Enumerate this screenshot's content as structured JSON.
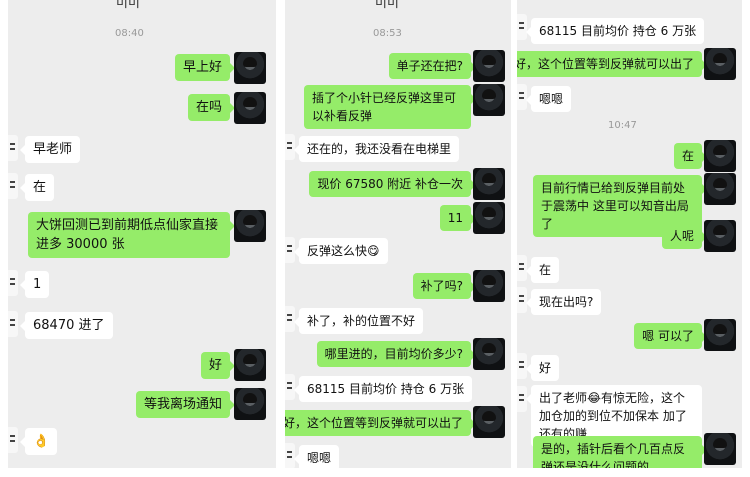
{
  "panel1": {
    "top_text": "미미",
    "timestamp": "08:40",
    "messages": [
      {
        "side": "me",
        "text": "早上好"
      },
      {
        "side": "me",
        "text": "在吗"
      },
      {
        "side": "them",
        "text": "早老师"
      },
      {
        "side": "them",
        "text": "在"
      },
      {
        "side": "me",
        "text": "大饼回测已到前期低点仙家直接进多 30000 张"
      },
      {
        "side": "them",
        "text": "1"
      },
      {
        "side": "them",
        "text": "68470 进了"
      },
      {
        "side": "me",
        "text": "好"
      },
      {
        "side": "me",
        "text": "等我离场通知"
      },
      {
        "side": "them",
        "text": "👌"
      }
    ]
  },
  "panel2": {
    "top_text": "미미",
    "timestamp": "08:53",
    "messages": [
      {
        "side": "me",
        "text": "单子还在把?"
      },
      {
        "side": "me",
        "text": "插了个小针已经反弹这里可以补看反弹"
      },
      {
        "side": "them",
        "text": "还在的，我还没看在电梯里"
      },
      {
        "side": "me",
        "text": "现价 67580 附近 补仓一次"
      },
      {
        "side": "me",
        "text": "11"
      },
      {
        "side": "them",
        "text": "反弹这么快😋"
      },
      {
        "side": "me",
        "text": "补了吗?"
      },
      {
        "side": "them",
        "text": "补了，补的位置不好"
      },
      {
        "side": "me",
        "text": "哪里进的，目前均价多少?"
      },
      {
        "side": "them",
        "text": "68115 目前均价 持仓 6 万张"
      },
      {
        "side": "me",
        "text": "好，这个位置等到反弹就可以出了"
      },
      {
        "side": "them",
        "text": "嗯嗯"
      }
    ]
  },
  "panel3": {
    "timestamp": "10:47",
    "messages": [
      {
        "side": "them",
        "text": "68115 目前均价 持仓 6 万张"
      },
      {
        "side": "me",
        "text": "好，这个位置等到反弹就可以出了"
      },
      {
        "side": "them",
        "text": "嗯嗯"
      },
      {
        "side": "me",
        "text": "在"
      },
      {
        "side": "me",
        "text": "目前行情已给到反弹目前处于震荡中 这里可以知音出局了"
      },
      {
        "side": "me",
        "text": "人呢"
      },
      {
        "side": "them",
        "text": "在"
      },
      {
        "side": "them",
        "text": "现在出吗?"
      },
      {
        "side": "me",
        "text": "嗯 可以了"
      },
      {
        "side": "them",
        "text": "好"
      },
      {
        "side": "them",
        "text": "出了老师😂有惊无险，这个加仓加的到位不加保本 加了还有的赚"
      },
      {
        "side": "me",
        "text": "是的，插针后看个几百点反弹还是没什么问题的"
      }
    ]
  },
  "colors": {
    "background": "#ededed",
    "my_bubble": "#95ec69",
    "their_bubble": "#ffffff",
    "timestamp": "#999999"
  },
  "icons": {
    "avatar": "user-avatar-icon",
    "contact_avatar": "contact-avatar-icon"
  }
}
